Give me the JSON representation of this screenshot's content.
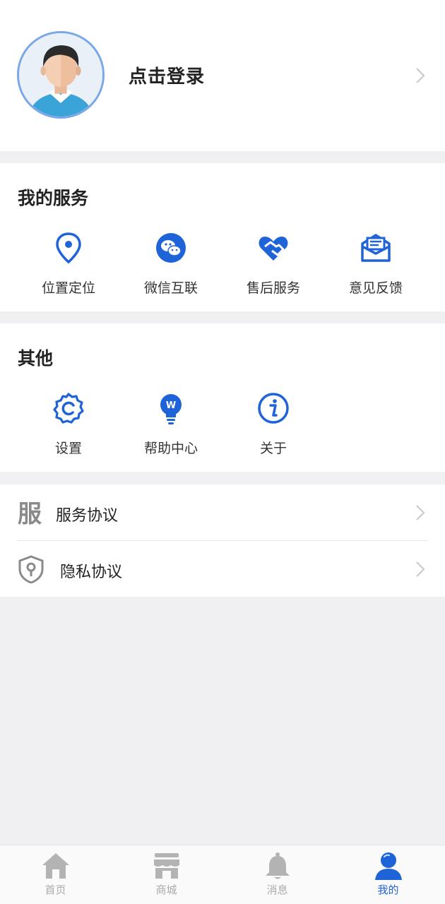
{
  "profile": {
    "login_text": "点击登录"
  },
  "my_services": {
    "title": "我的服务",
    "items": [
      {
        "label": "位置定位",
        "icon": "location-pin-icon"
      },
      {
        "label": "微信互联",
        "icon": "wechat-icon"
      },
      {
        "label": "售后服务",
        "icon": "handshake-heart-icon"
      },
      {
        "label": "意见反馈",
        "icon": "feedback-envelope-icon"
      }
    ]
  },
  "others": {
    "title": "其他",
    "items": [
      {
        "label": "设置",
        "icon": "gear-icon"
      },
      {
        "label": "帮助中心",
        "icon": "lightbulb-icon"
      },
      {
        "label": "关于",
        "icon": "info-icon"
      }
    ]
  },
  "list": [
    {
      "label": "服务协议",
      "icon": "service-char-icon",
      "icon_char": "服"
    },
    {
      "label": "隐私协议",
      "icon": "shield-lock-icon"
    }
  ],
  "tabbar": {
    "items": [
      {
        "label": "首页",
        "icon": "home-icon",
        "active": false
      },
      {
        "label": "商城",
        "icon": "store-icon",
        "active": false
      },
      {
        "label": "消息",
        "icon": "bell-icon",
        "active": false
      },
      {
        "label": "我的",
        "icon": "user-icon",
        "active": true
      }
    ]
  },
  "colors": {
    "accent": "#1f63d9",
    "inactive": "#aaaaaa",
    "background": "#f0f0f2"
  }
}
